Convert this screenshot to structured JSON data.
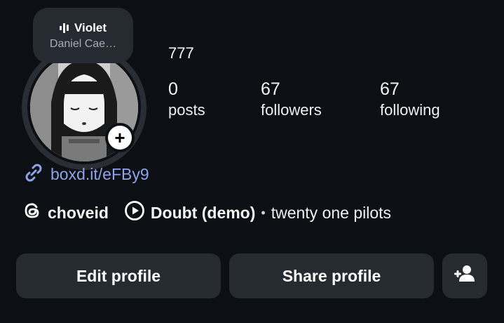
{
  "note": {
    "song": "Violet",
    "artist": "Daniel Cae…"
  },
  "profile": {
    "display_name": "777",
    "link": "boxd.it/eFBy9",
    "threads_handle": "choveid",
    "music_song": "Doubt (demo)",
    "music_separator": "•",
    "music_artist": "twenty one pilots"
  },
  "stats": [
    {
      "value": "0",
      "label": "posts"
    },
    {
      "value": "67",
      "label": "followers"
    },
    {
      "value": "67",
      "label": "following"
    }
  ],
  "buttons": {
    "edit": "Edit profile",
    "share": "Share profile"
  },
  "icons": {
    "add_story": "plus-icon",
    "link": "link-icon",
    "threads": "threads-icon",
    "play": "play-circle-icon",
    "add_person": "add-person-icon",
    "audio_bars": "audio-bars-icon"
  },
  "colors": {
    "background": "#0c0f14",
    "button": "#262a31",
    "link": "#8fa4e8"
  }
}
